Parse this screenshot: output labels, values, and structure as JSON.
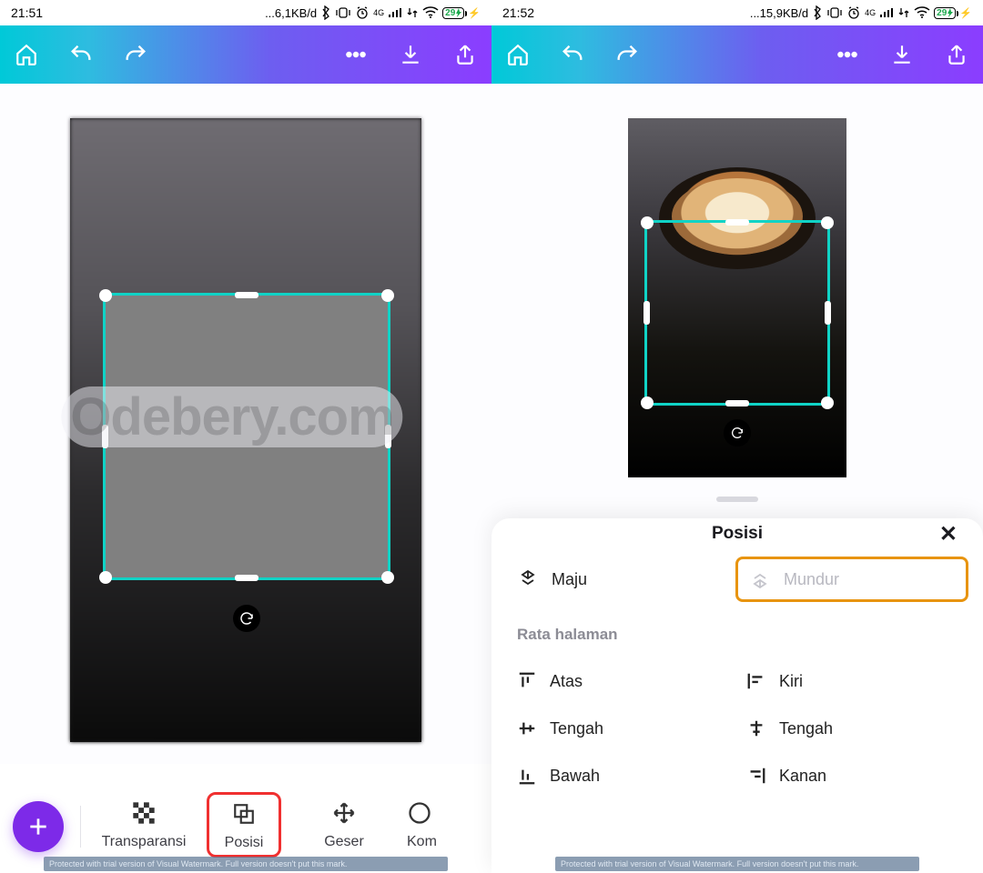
{
  "left": {
    "status": {
      "time": "21:51",
      "net": "...6,1KB/d",
      "batt": "29"
    },
    "bottom_items": [
      "Transparansi",
      "Posisi",
      "Geser",
      "Kom"
    ]
  },
  "right": {
    "status": {
      "time": "21:52",
      "net": "...15,9KB/d",
      "batt": "29"
    },
    "sheet": {
      "title": "Posisi",
      "opts": {
        "maju": "Maju",
        "mundur": "Mundur"
      },
      "section": "Rata halaman",
      "align": {
        "atas": "Atas",
        "kiri": "Kiri",
        "tengah_v": "Tengah",
        "tengah_h": "Tengah",
        "bawah": "Bawah",
        "kanan": "Kanan"
      }
    }
  },
  "watermark": "Odebery.com",
  "wm_strip": "Protected with trial version of Visual Watermark. Full version doesn't put this mark."
}
